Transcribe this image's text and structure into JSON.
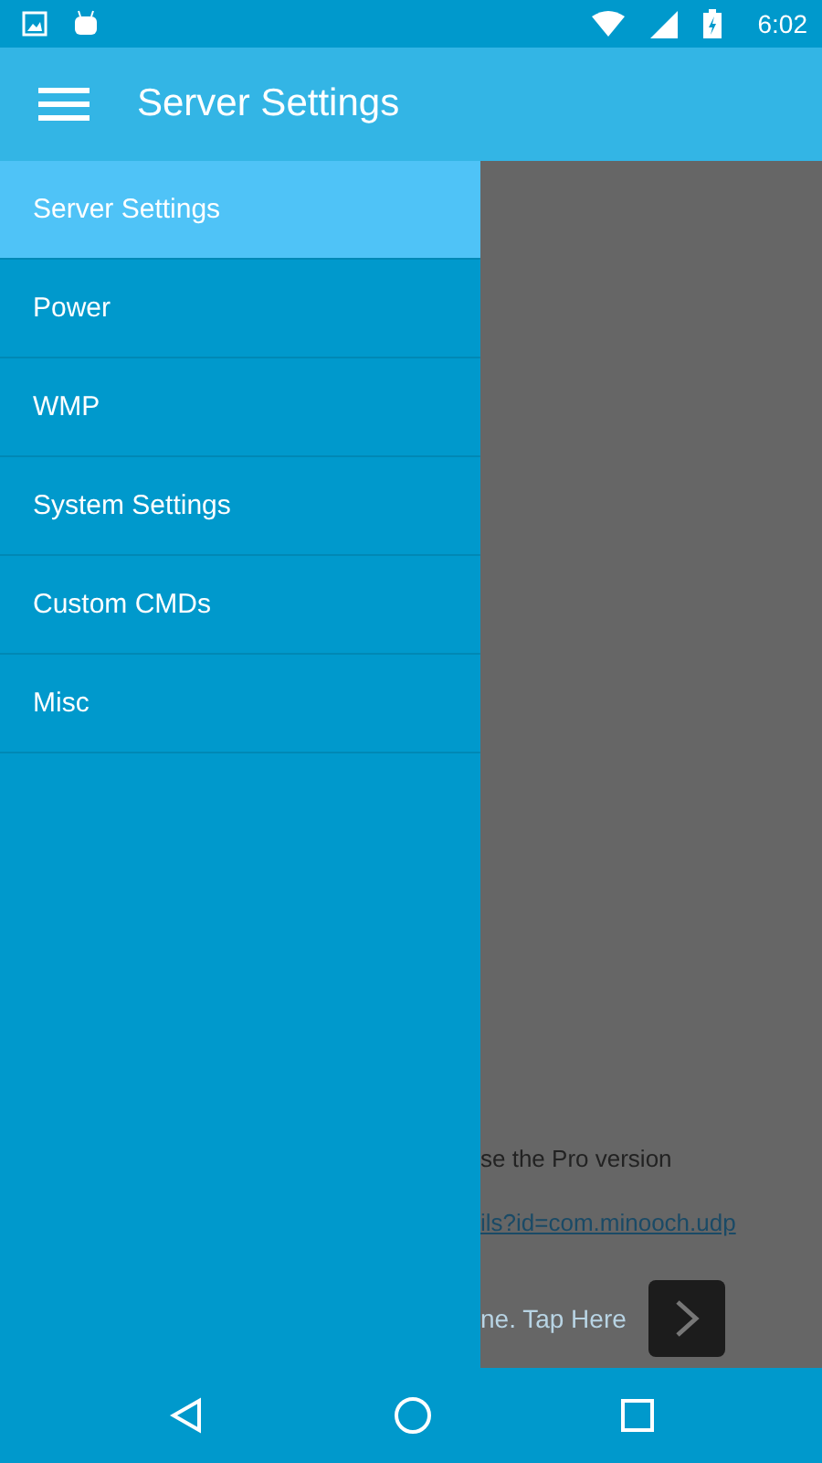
{
  "status_bar": {
    "time": "6:02"
  },
  "app_bar": {
    "title": "Server Settings"
  },
  "drawer": {
    "items": [
      {
        "label": "Server Settings",
        "selected": true
      },
      {
        "label": "Power",
        "selected": false
      },
      {
        "label": "WMP",
        "selected": false
      },
      {
        "label": "System Settings",
        "selected": false
      },
      {
        "label": "Custom CMDs",
        "selected": false
      },
      {
        "label": "Misc",
        "selected": false
      }
    ]
  },
  "background": {
    "pro_text": "se the Pro version",
    "link": "ils?id=com.minooch.udp",
    "ad_text": "ne. Tap Here"
  }
}
